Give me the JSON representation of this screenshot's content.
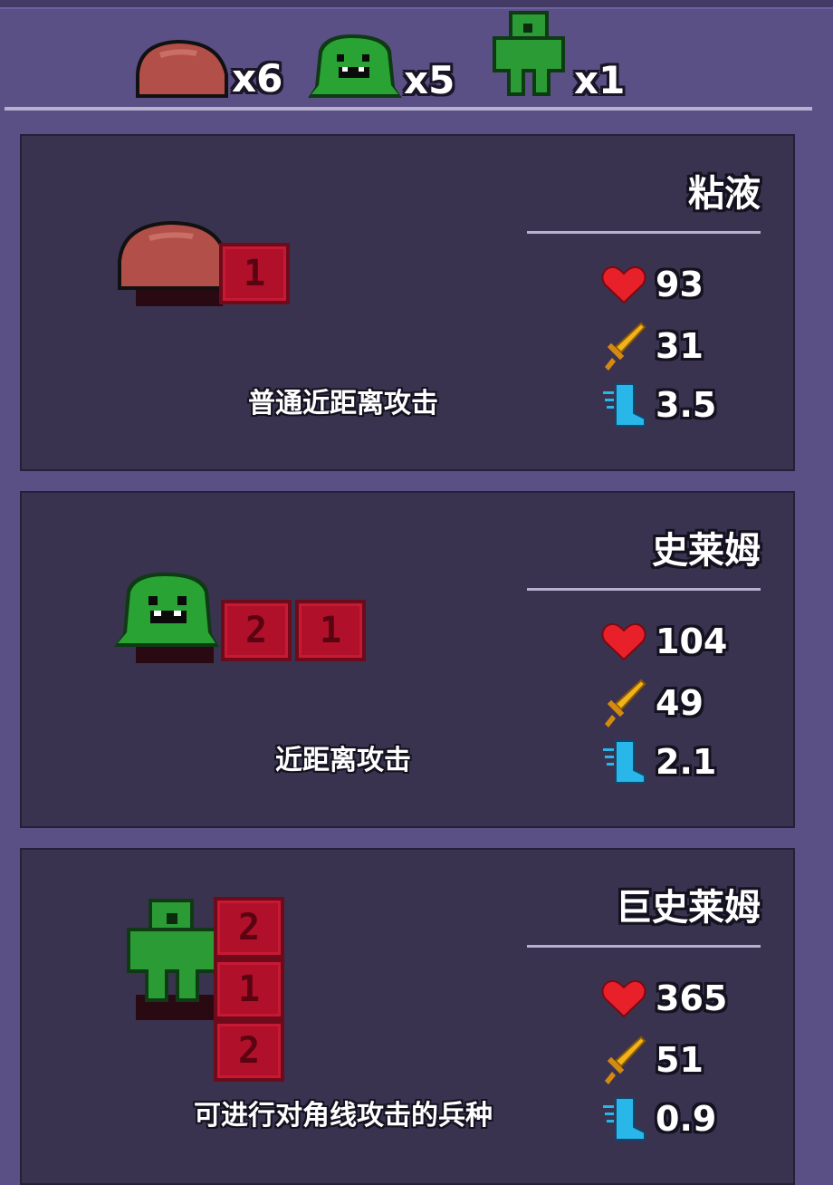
{
  "header": {
    "units": [
      {
        "icon": "red-slime-icon",
        "count": "x6"
      },
      {
        "icon": "green-slime-icon",
        "count": "x5"
      },
      {
        "icon": "giant-slime-icon",
        "count": "x1"
      }
    ]
  },
  "cards": [
    {
      "name": "粘液",
      "hp": "93",
      "attack": "31",
      "speed": "3.5",
      "description": "普通近距离攻击",
      "tiles": [
        "1"
      ],
      "sprite": "red-slime-icon"
    },
    {
      "name": "史莱姆",
      "hp": "104",
      "attack": "49",
      "speed": "2.1",
      "description": "近距离攻击",
      "tiles": [
        "2",
        "1"
      ],
      "sprite": "green-slime-icon"
    },
    {
      "name": "巨史莱姆",
      "hp": "365",
      "attack": "51",
      "speed": "0.9",
      "description": "可进行对角线攻击的兵种",
      "tiles": [
        "2",
        "1",
        "2"
      ],
      "sprite": "giant-slime-icon"
    }
  ],
  "colors": {
    "background": "#5b5085",
    "card": "#3a3350",
    "tile": "#b0102a",
    "heart": "#e8202a",
    "sword": "#f2b21c",
    "boot": "#29b6e8"
  }
}
